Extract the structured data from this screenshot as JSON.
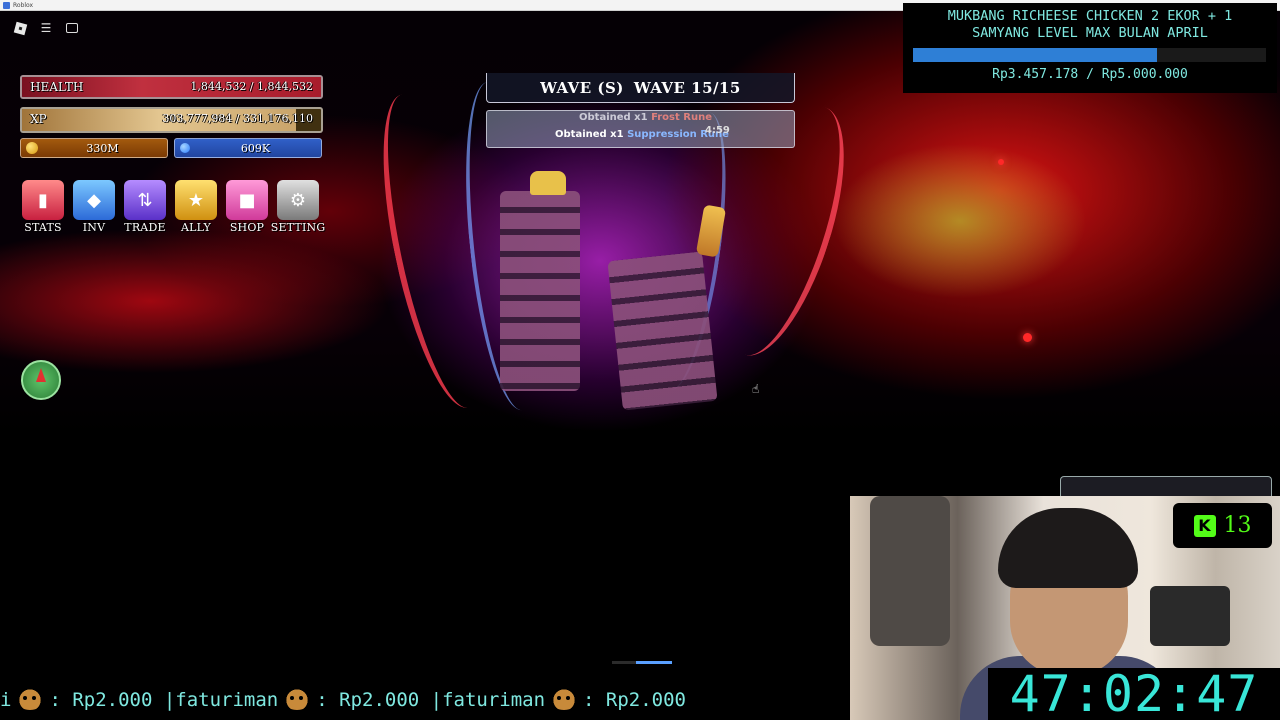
{
  "window": {
    "title": "Roblox"
  },
  "hud": {
    "health": {
      "label": "HEALTH",
      "value": "1,844,532 / 1,844,532",
      "fill": 1.0
    },
    "xp": {
      "label": "XP",
      "value": "303,777,984 / 331,176,110",
      "fill": 0.917
    },
    "gold": "330M",
    "gems": "609K",
    "menu": [
      {
        "label": "STATS",
        "icon": "stats-icon"
      },
      {
        "label": "INV",
        "icon": "inventory-icon"
      },
      {
        "label": "TRADE",
        "icon": "trade-icon"
      },
      {
        "label": "ALLY",
        "icon": "ally-icon"
      },
      {
        "label": "SHOP",
        "icon": "shop-icon"
      },
      {
        "label": "SETTING",
        "icon": "gear-icon"
      }
    ]
  },
  "wave": {
    "label": "WAVE (S)",
    "value": "WAVE 15/15"
  },
  "notifications": {
    "line1_prefix": "Obtained x1",
    "line1_item": "Frost Rune",
    "line2_prefix": "Obtained x1",
    "line2_item": "Suppression Rune",
    "timer": "4:59"
  },
  "overlay": {
    "goal_title_line1": "MUKBANG RICHEESE CHICKEN 2 EKOR + 1",
    "goal_title_line2": "SAMYANG LEVEL MAX BULAN APRIL",
    "goal_amount": "Rp3.457.178 / Rp5.000.000",
    "goal_progress": 0.691,
    "kick_viewers": "13",
    "clock": "47:02:47",
    "ticker": [
      {
        "name": "i",
        "amount": ": Rp2.000 | "
      },
      {
        "name": "faturiman",
        "amount": ": Rp2.000 | "
      },
      {
        "name": "faturiman",
        "amount": ": Rp2.000"
      }
    ]
  },
  "colors": {
    "accent": "#7fe8e0",
    "clock": "#39e6d8",
    "health": "#c0303f",
    "xp": "#e3c690",
    "gold": "#a35a0e",
    "gems": "#3060c8",
    "kick": "#53fc18"
  }
}
